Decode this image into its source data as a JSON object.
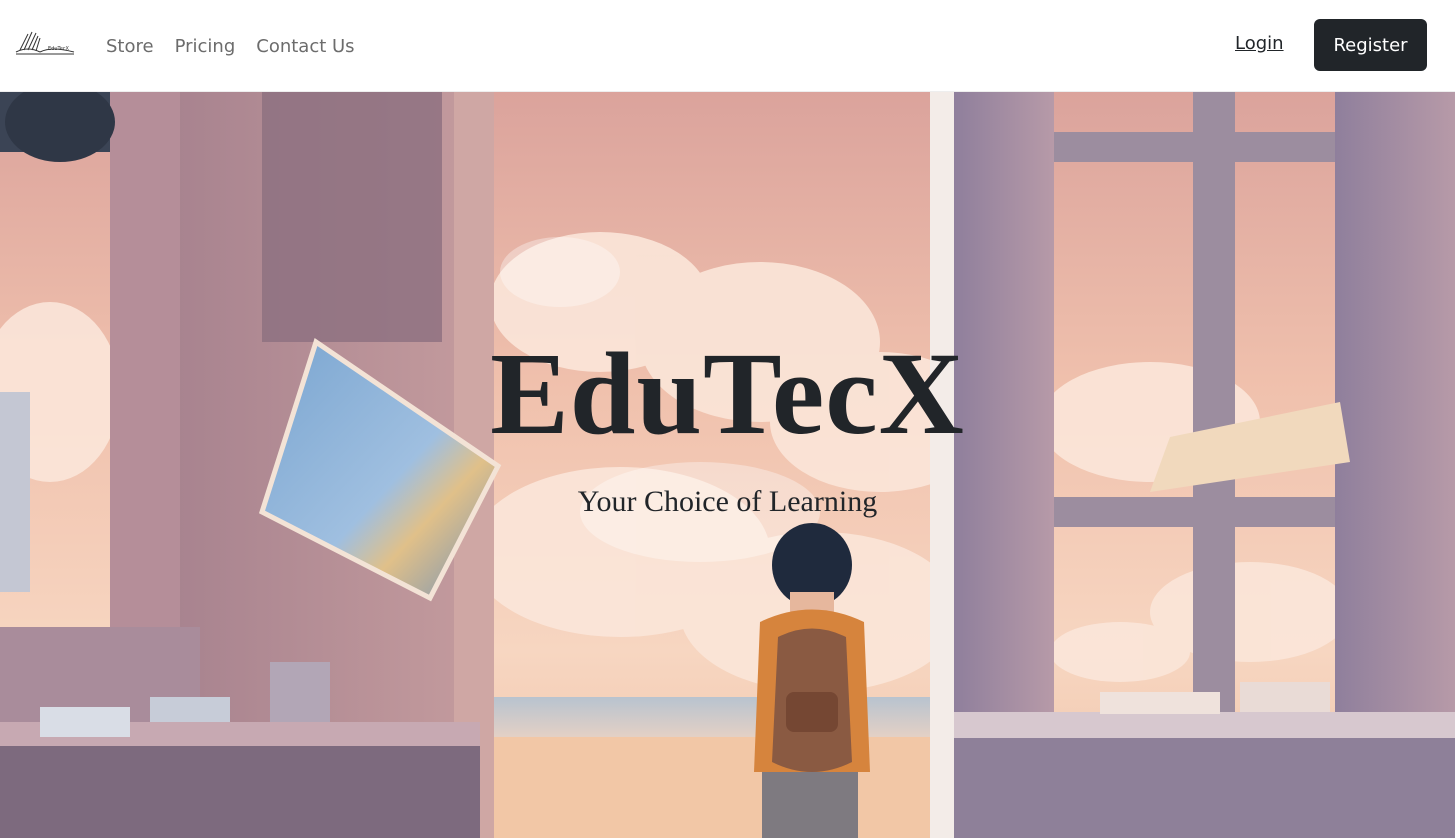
{
  "brand": {
    "logo_icon": "book-logo-icon"
  },
  "nav": {
    "links": [
      {
        "label": "Store"
      },
      {
        "label": "Pricing"
      },
      {
        "label": "Contact Us"
      }
    ],
    "login_label": "Login",
    "register_label": "Register"
  },
  "hero": {
    "title": "EduTecX",
    "subtitle": "Your Choice of Learning",
    "background_image": "anime-style illustration: student with backpack looking out to sea between window frames"
  },
  "colors": {
    "dark": "#212529",
    "nav_link": "#6c6c6c",
    "sky_pink": "#f2c4ad"
  }
}
